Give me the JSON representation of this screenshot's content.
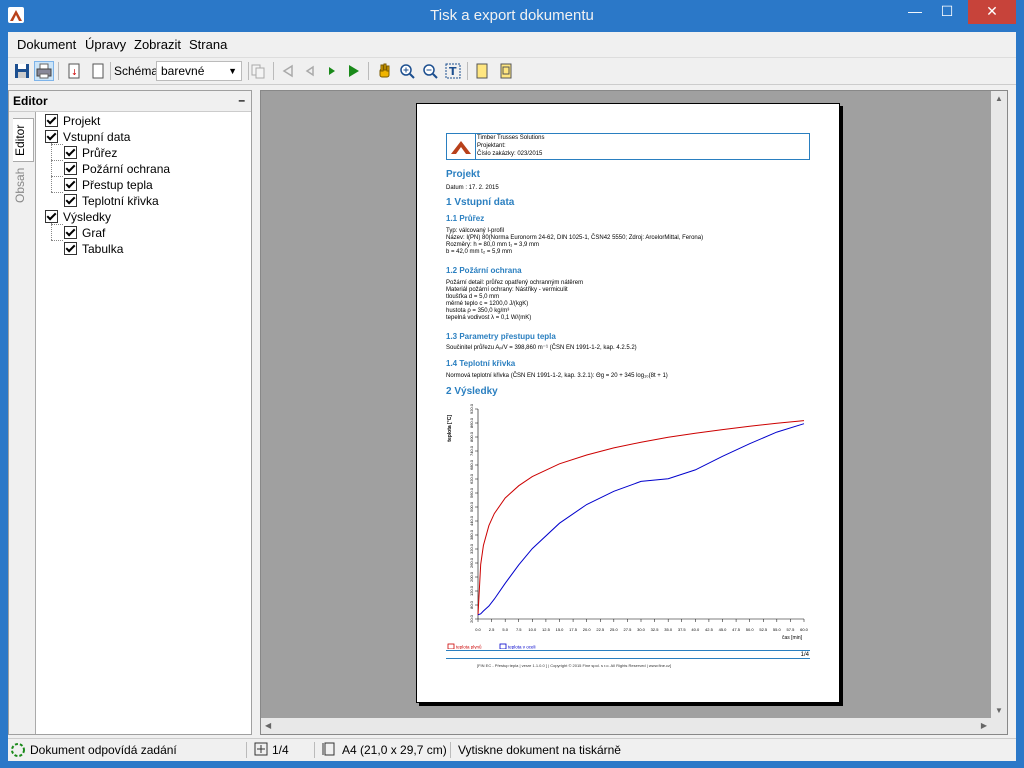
{
  "window": {
    "title": "Tisk a export dokumentu"
  },
  "menu": [
    "Dokument",
    "Úpravy",
    "Zobrazit",
    "Strana"
  ],
  "toolbar": {
    "schema_label": "Schéma:",
    "schema_value": "barevné"
  },
  "editor": {
    "title": "Editor",
    "collapse": "–",
    "tabs": [
      "Editor",
      "Obsah"
    ],
    "tree": [
      {
        "label": "Projekt",
        "checked": true
      },
      {
        "label": "Vstupní data",
        "checked": true
      },
      {
        "label": "Průřez",
        "checked": true
      },
      {
        "label": "Požární ochrana",
        "checked": true
      },
      {
        "label": "Přestup tepla",
        "checked": true
      },
      {
        "label": "Teplotní křivka",
        "checked": true
      },
      {
        "label": "Výsledky",
        "checked": true
      },
      {
        "label": "Graf",
        "checked": true
      },
      {
        "label": "Tabulka",
        "checked": true
      }
    ]
  },
  "doc": {
    "header": [
      "Timber Trusses Solutions",
      "Projektant:",
      "Číslo zakázky: 023/2015"
    ],
    "sections": {
      "projekt": "Projekt",
      "datum": "Datum  :  17. 2. 2015",
      "vstupni": "1 Vstupní data",
      "prurez": "1.1 Průřez",
      "pozarni": "1.2 Požární ochrana",
      "prestup": "1.3 Parametry přestupu tepla",
      "krivka": "1.4 Teplotní křivka",
      "vysledky": "2 Výsledky"
    },
    "prurez_lines": [
      "Typ: válcovaný I-profil",
      "Název: I(PN) 80(Norma Euronorm 24-62, DIN  1025-1, ČSN42 5550; Zdroj: ArcelorMittal, Ferona)",
      "Rozměry:  h  =  80,0 mm         t₁ =  3,9 mm",
      "              b  =  42,0 mm         t₂ =  5,9 mm"
    ],
    "pozarni_lines": [
      "Požární detail: průřez opatřený ochranným nátěrem",
      "Materiál požární ochrany: Nástřiky - vermiculit",
      "    tloušťka                 d =         5,0 mm",
      "    měrné teplo             c =   1200,0 J/(kgK)",
      "    hustota                  ρ =     350,0 kg/m³",
      "    tepelná vodivost    λ =         0,1 W/(mK)"
    ],
    "prestup_line": "Součinitel průřezu  Aₚ/V  =  398,860  m⁻¹   (ČSN EN 1991-1-2, kap. 4.2.5.2)",
    "krivka_line": "Normová teplotní křivka (ČSN EN 1991-1-2, kap.  3.2.1):      Θg = 20 + 345 log₁₀(8t + 1)",
    "footer_page": "1/4",
    "footer_text": "[FIN EC - Přestup tepla | verze 1.1.0.0 ] | Copyright © 2015 Fine spol. s r.o. All Rights Reserved | www.fine.cz]"
  },
  "chart_data": {
    "type": "line",
    "title": "",
    "xlabel": "čas [min]",
    "ylabel": "teplota [°C]",
    "xlim": [
      0,
      60
    ],
    "ylim": [
      0,
      1000
    ],
    "x_ticks": [
      "0.0",
      "2.5",
      "5.0",
      "7.5",
      "10.0",
      "12.5",
      "15.0",
      "17.5",
      "20.0",
      "22.5",
      "25.0",
      "27.5",
      "30.0",
      "32.5",
      "35.0",
      "37.5",
      "40.0",
      "42.5",
      "45.0",
      "47.5",
      "50.0",
      "52.5",
      "55.0",
      "57.5",
      "60.0"
    ],
    "y_ticks": [
      "20.0",
      "80.0",
      "120.0",
      "200.0",
      "260.0",
      "320.0",
      "380.0",
      "440.0",
      "500.0",
      "560.0",
      "620.0",
      "680.0",
      "740.0",
      "800.0",
      "860.0",
      "920.0"
    ],
    "x": [
      0,
      0.5,
      1,
      2,
      3,
      5,
      7.5,
      10,
      15,
      20,
      25,
      30,
      35,
      40,
      45,
      50,
      55,
      60
    ],
    "series": [
      {
        "name": "teplota plynů",
        "color": "#cc0000",
        "values": [
          20,
          260,
          350,
          445,
          502,
          576,
          635,
          678,
          739,
          781,
          815,
          842,
          865,
          885,
          902,
          918,
          932,
          945
        ]
      },
      {
        "name": "teplota v oceli",
        "color": "#0000cc",
        "values": [
          20,
          25,
          38,
          62,
          95,
          170,
          258,
          335,
          456,
          545,
          608,
          655,
          668,
          710,
          775,
          835,
          890,
          930
        ]
      }
    ],
    "legend": "bottom-left"
  },
  "status": {
    "state": "Dokument odpovídá zadání",
    "pages": "1/4",
    "format": "A4 (21,0 x 29,7 cm)",
    "hint": "Vytiskne dokument na tiskárně"
  }
}
